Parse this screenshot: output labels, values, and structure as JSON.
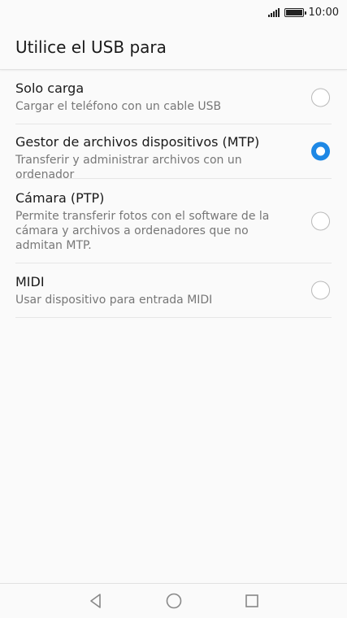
{
  "status_bar": {
    "time": "10:00",
    "icons": [
      "signal-icon",
      "battery-icon"
    ]
  },
  "header": {
    "title": "Utilice el USB para"
  },
  "options": [
    {
      "title": "Solo carga",
      "description": "Cargar el teléfono con un cable USB",
      "selected": false
    },
    {
      "title": "Gestor de archivos dispositivos (MTP)",
      "description": "Transferir y administrar archivos con un ordenador",
      "selected": true
    },
    {
      "title": "Cámara (PTP)",
      "description": "Permite transferir fotos con el software de la cámara y archivos a ordenadores que no admitan MTP.",
      "selected": false
    },
    {
      "title": "MIDI",
      "description": "Usar dispositivo para entrada MIDI",
      "selected": false
    }
  ],
  "nav_bar": {
    "icons": [
      "back-icon",
      "home-icon",
      "recents-icon"
    ]
  },
  "colors": {
    "accent": "#1e88e5",
    "background": "#fafafa",
    "divider": "#e6e6e6"
  }
}
